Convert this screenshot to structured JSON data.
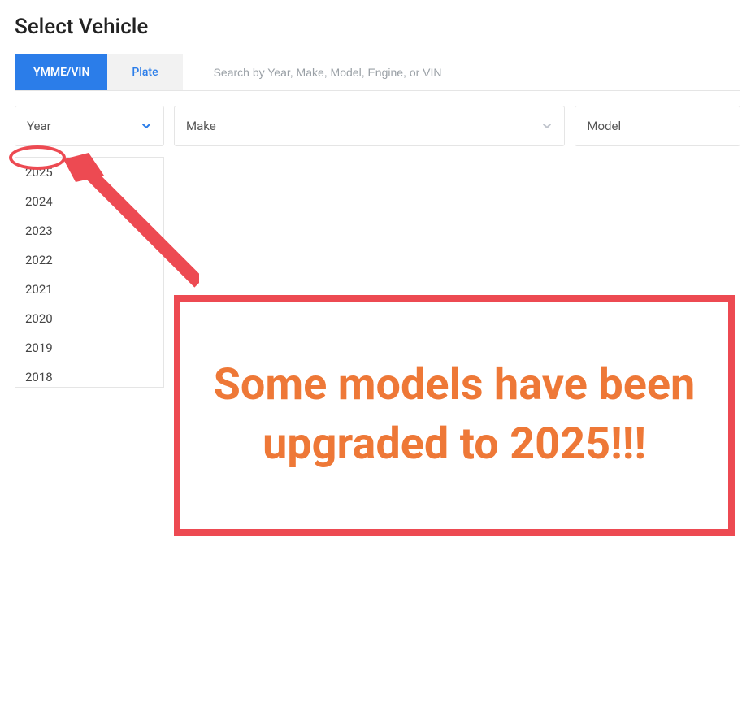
{
  "header": {
    "title": "Select Vehicle"
  },
  "tabs": {
    "ymme_vin": "YMME/VIN",
    "plate": "Plate"
  },
  "search": {
    "placeholder": "Search by Year, Make, Model, Engine, or VIN"
  },
  "selectors": {
    "year": "Year",
    "make": "Make",
    "model": "Model"
  },
  "year_options": [
    "2025",
    "2024",
    "2023",
    "2022",
    "2021",
    "2020",
    "2019",
    "2018"
  ],
  "annotation": {
    "text": "Some models have been upgraded to 2025!!!"
  },
  "colors": {
    "primary_blue": "#2b7de9",
    "annotation_red": "#ed4a52",
    "annotation_orange": "#ee7837"
  }
}
